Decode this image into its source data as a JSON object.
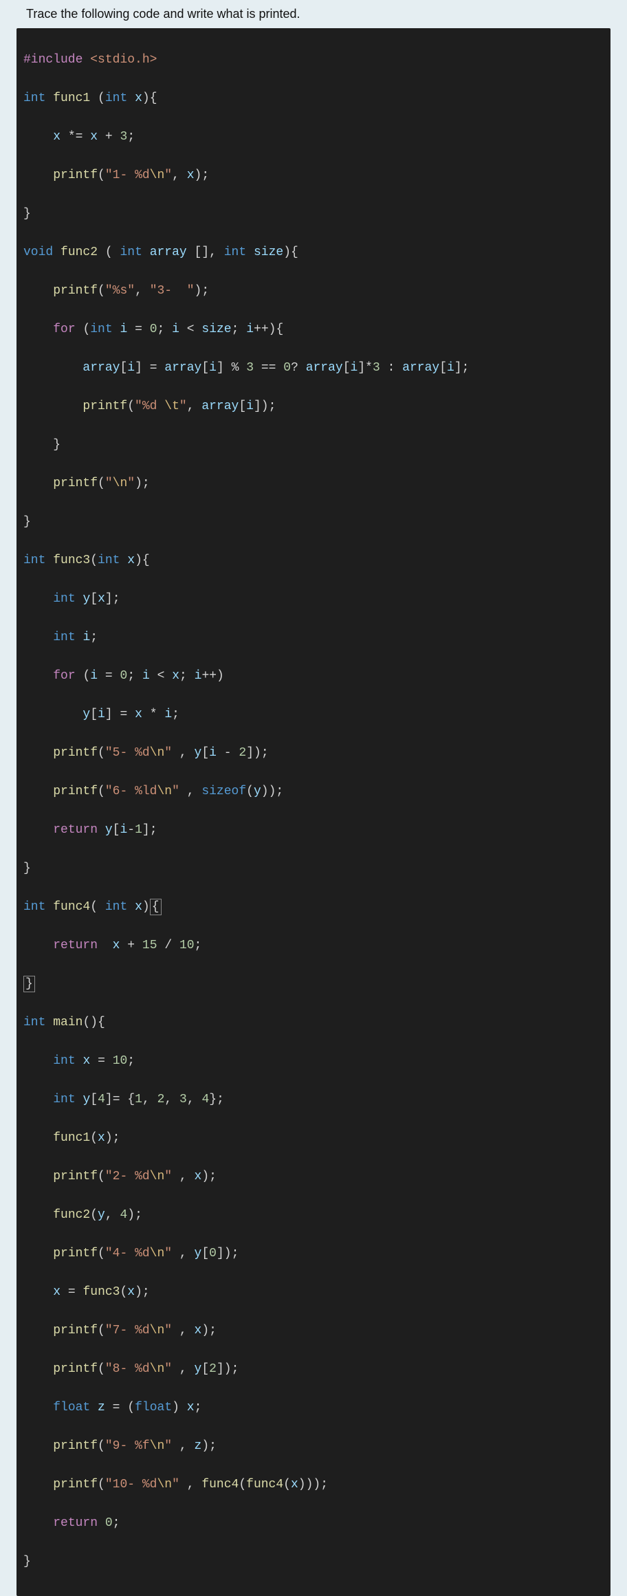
{
  "question": "Trace the following code and write what is printed.",
  "code": {
    "l01": {
      "include": "#include",
      "hdr": "<stdio.h>"
    },
    "l02": {
      "kw1": "int",
      "fn": "func1",
      "paren": "(",
      "kw2": "int",
      "id": "x",
      "close": "){"
    },
    "l03": {
      "id": "x",
      "op1": "*=",
      "id2": "x",
      "op2": "+",
      "num": "3",
      "semi": ";"
    },
    "l04": {
      "fn": "printf",
      "open": "(",
      "s1": "\"1- ",
      "s2": "%d",
      "esc": "\\n",
      "s3": "\"",
      "c": ",",
      "id": "x",
      "close": ");"
    },
    "l05": {
      "brace": "}"
    },
    "l06": {
      "kw1": "void",
      "fn": "func2",
      "open": "( ",
      "kw2": "int",
      "id1": "array",
      "brk": "[]",
      "c": ",",
      "kw3": "int",
      "id2": "size",
      "close": "){"
    },
    "l07": {
      "fn": "printf",
      "open": "(",
      "s1": "\"",
      "s2": "%s",
      "s3": "\"",
      "c": ",",
      "str": "\"3-  \"",
      "close": ");"
    },
    "l08": {
      "kw": "for",
      "open": "(",
      "kw2": "int",
      "id": "i",
      "eq": "=",
      "num": "0",
      "semi": ";",
      "id2": "i",
      "lt": "<",
      "id3": "size",
      "semi2": ";",
      "id4": "i",
      "inc": "++",
      "close": "){"
    },
    "l09": {
      "id1": "array",
      "b1": "[",
      "id2": "i",
      "b2": "]",
      "eq": "=",
      "id3": "array",
      "b3": "[",
      "id4": "i",
      "b4": "]",
      "mod": "%",
      "num1": "3",
      "eqeq": "==",
      "num2": "0",
      "q": "?",
      "id5": "array",
      "b5": "[",
      "id6": "i",
      "b6": "]",
      "mul": "*",
      "num3": "3",
      "colon": ":",
      "id7": "array",
      "b7": "[",
      "id8": "i",
      "b8": "]",
      "semi": ";"
    },
    "l10": {
      "fn": "printf",
      "open": "(",
      "s1": "\"",
      "s2": "%d",
      "sp": " ",
      "esc": "\\t",
      "s3": "\"",
      "c": ",",
      "id": "array",
      "b1": "[",
      "id2": "i",
      "b2": "]",
      "close": ");"
    },
    "l11": {
      "brace": "}"
    },
    "l12": {
      "fn": "printf",
      "open": "(",
      "s1": "\"",
      "esc": "\\n",
      "s2": "\"",
      "close": ");"
    },
    "l13": {
      "brace": "}"
    },
    "l14": {
      "kw1": "int",
      "fn": "func3",
      "open": "(",
      "kw2": "int",
      "id": "x",
      "close": "){"
    },
    "l15": {
      "kw": "int",
      "id": "y",
      "b1": "[",
      "id2": "x",
      "b2": "]",
      "semi": ";"
    },
    "l16": {
      "kw": "int",
      "id": "i",
      "semi": ";"
    },
    "l17": {
      "kw": "for",
      "open": "(",
      "id": "i",
      "eq": "=",
      "num": "0",
      "semi": ";",
      "id2": "i",
      "lt": "<",
      "id3": "x",
      "semi2": ";",
      "id4": "i",
      "inc": "++",
      "close": ")"
    },
    "l18": {
      "id": "y",
      "b1": "[",
      "id2": "i",
      "b2": "]",
      "eq": "=",
      "id3": "x",
      "mul": "*",
      "id4": "i",
      "semi": ";"
    },
    "l19": {
      "fn": "printf",
      "open": "(",
      "s1": "\"5- ",
      "s2": "%d",
      "esc": "\\n",
      "s3": "\"",
      "c": ",",
      "id": "y",
      "b1": "[",
      "id2": "i",
      "op": "-",
      "num": "2",
      "b2": "]",
      "close": ");"
    },
    "l20": {
      "fn": "printf",
      "open": "(",
      "s1": "\"6- ",
      "s2": "%ld",
      "esc": "\\n",
      "s3": "\"",
      "c": ",",
      "kw": "sizeof",
      "open2": "(",
      "id": "y",
      "close2": ")",
      "close": ");"
    },
    "l21": {
      "kw": "return",
      "id": "y",
      "b1": "[",
      "id2": "i",
      "op": "-",
      "num": "1",
      "b2": "]",
      "semi": ";"
    },
    "l22": {
      "brace": "}"
    },
    "l23": {
      "kw1": "int",
      "fn": "func4",
      "open": "( ",
      "kw2": "int",
      "id": "x",
      "close": ")",
      "brace": "{"
    },
    "l24": {
      "kw": "return",
      "id": "x",
      "op1": "+",
      "num1": "15",
      "op2": "/",
      "num2": "10",
      "semi": ";"
    },
    "l25": {
      "brace": "}"
    },
    "l26": {
      "kw": "int",
      "fn": "main",
      "open": "()",
      "brace": "{"
    },
    "l27": {
      "kw": "int",
      "id": "x",
      "eq": "=",
      "num": "10",
      "semi": ";"
    },
    "l28": {
      "kw": "int",
      "id": "y",
      "b1": "[",
      "num": "4",
      "b2": "]",
      "eq": "=",
      "open": "{",
      "n1": "1",
      "c1": ",",
      "n2": "2",
      "c2": ",",
      "n3": "3",
      "c3": ",",
      "n4": "4",
      "close": "}",
      "semi": ";"
    },
    "l29": {
      "fn": "func1",
      "open": "(",
      "id": "x",
      "close": ");"
    },
    "l30": {
      "fn": "printf",
      "open": "(",
      "s1": "\"2- ",
      "s2": "%d",
      "esc": "\\n",
      "s3": "\"",
      "c": ",",
      "id": "x",
      "close": ");"
    },
    "l31": {
      "fn": "func2",
      "open": "(",
      "id": "y",
      "c": ",",
      "num": "4",
      "close": ");"
    },
    "l32": {
      "fn": "printf",
      "open": "(",
      "s1": "\"4- ",
      "s2": "%d",
      "esc": "\\n",
      "s3": "\"",
      "c": ",",
      "id": "y",
      "b1": "[",
      "num": "0",
      "b2": "]",
      "close": ");"
    },
    "l33": {
      "id": "x",
      "eq": "=",
      "fn": "func3",
      "open": "(",
      "id2": "x",
      "close": ");"
    },
    "l34": {
      "fn": "printf",
      "open": "(",
      "s1": "\"7- ",
      "s2": "%d",
      "esc": "\\n",
      "s3": "\"",
      "c": ",",
      "id": "x",
      "close": ");"
    },
    "l35": {
      "fn": "printf",
      "open": "(",
      "s1": "\"8- ",
      "s2": "%d",
      "esc": "\\n",
      "s3": "\"",
      "c": ",",
      "id": "y",
      "b1": "[",
      "num": "2",
      "b2": "]",
      "close": ");"
    },
    "l36": {
      "kw": "float",
      "id": "z",
      "eq": "=",
      "open": "(",
      "kw2": "float",
      "close": ")",
      "id2": "x",
      "semi": ";"
    },
    "l37": {
      "fn": "printf",
      "open": "(",
      "s1": "\"9- ",
      "s2": "%f",
      "esc": "\\n",
      "s3": "\"",
      "c": ",",
      "id": "z",
      "close": ");"
    },
    "l38": {
      "fn": "printf",
      "open": "(",
      "s1": "\"10- ",
      "s2": "%d",
      "esc": "\\n",
      "s3": "\"",
      "c": ",",
      "fn2": "func4",
      "open2": "(",
      "fn3": "func4",
      "open3": "(",
      "id": "x",
      "close3": ")",
      "close2": ")",
      "close": ");"
    },
    "l39": {
      "kw": "return",
      "num": "0",
      "semi": ";"
    },
    "l40": {
      "brace": "}"
    }
  }
}
